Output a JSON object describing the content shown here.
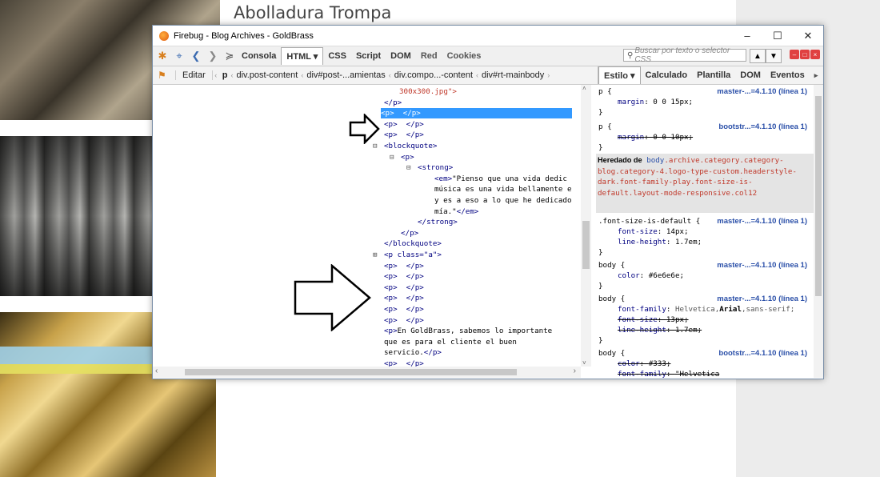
{
  "background_page": {
    "title": "Abolladura Trompa"
  },
  "window": {
    "title": "Firebug - Blog Archives - GoldBrass",
    "controls": [
      "–",
      "☐",
      "✕"
    ]
  },
  "toolbar": {
    "tabs": [
      "Consola",
      "HTML ▾",
      "CSS",
      "Script",
      "DOM",
      "Red",
      "Cookies"
    ],
    "active_tab": "HTML ▾",
    "search_placeholder": "Buscar por texto o selector CSS"
  },
  "subbar": {
    "edit_label": "Editar",
    "breadcrumbs": [
      "p",
      "div.post-content",
      "div#post-...amientas",
      "div.compo...-content",
      "div#rt-mainbody"
    ],
    "right_tabs": [
      "Estilo ▾",
      "Calculado",
      "Plantilla",
      "DOM",
      "Eventos"
    ],
    "active_right_tab": "Estilo ▾"
  },
  "html_tree": [
    {
      "text": "300x300.jpg\">",
      "indent": 308,
      "kind": "str"
    },
    {
      "text": "</p>",
      "indent": 289,
      "kind": "tag"
    },
    {
      "text": "<p>  </p>",
      "indent": 289,
      "kind": "tag",
      "selected": true
    },
    {
      "text": "<p>  </p>",
      "indent": 289,
      "kind": "tag"
    },
    {
      "text": "<p>  </p>",
      "indent": 289,
      "kind": "tag"
    },
    {
      "text": "<blockquote>",
      "indent": 289,
      "kind": "tag",
      "toggle": "⊟"
    },
    {
      "text": "<p>",
      "indent": 310,
      "kind": "tag",
      "toggle": "⊟"
    },
    {
      "text": "<strong>",
      "indent": 331,
      "kind": "tag",
      "toggle": "⊟"
    },
    {
      "text": "<em>\"Pienso que una vida dedic",
      "indent": 352,
      "kind": "mixed"
    },
    {
      "text": "música es una vida bellamente e",
      "indent": 352,
      "kind": "txt"
    },
    {
      "text": "y es a eso a lo que he dedicado",
      "indent": 352,
      "kind": "txt"
    },
    {
      "text": "mía.\"</em>",
      "indent": 352,
      "kind": "mixed2"
    },
    {
      "text": "</strong>",
      "indent": 331,
      "kind": "tag"
    },
    {
      "text": "</p>",
      "indent": 310,
      "kind": "tag"
    },
    {
      "text": "</blockquote>",
      "indent": 289,
      "kind": "tag"
    },
    {
      "text": "<p class=\"a\">",
      "indent": 289,
      "kind": "tag",
      "toggle": "⊞"
    },
    {
      "text": "<p>  </p>",
      "indent": 289,
      "kind": "tag"
    },
    {
      "text": "<p>  </p>",
      "indent": 289,
      "kind": "tag"
    },
    {
      "text": "<p>  </p>",
      "indent": 289,
      "kind": "tag"
    },
    {
      "text": "<p>  </p>",
      "indent": 289,
      "kind": "tag"
    },
    {
      "text": "<p>  </p>",
      "indent": 289,
      "kind": "tag"
    },
    {
      "text": "<p>  </p>",
      "indent": 289,
      "kind": "tag"
    },
    {
      "text": "<p>En GoldBrass, sabemos lo importante",
      "indent": 289,
      "kind": "mixed3"
    },
    {
      "text": "que es para el cliente el buen",
      "indent": 289,
      "kind": "txt"
    },
    {
      "text": "servicio.</p>",
      "indent": 289,
      "kind": "mixed4"
    },
    {
      "text": "<p>  </p>",
      "indent": 289,
      "kind": "tag"
    }
  ],
  "css_rules": {
    "rule1": {
      "selector": "p {",
      "source": "master-...=4.1.10 (línea 1)",
      "prop": "margin",
      "value": "0 0 15px;",
      "close": "}"
    },
    "rule2": {
      "selector": "p {",
      "source": "bootstr...=4.1.10 (línea 1)",
      "prop": "margin",
      "value": "0 0 10px;",
      "close": "}"
    },
    "inherited": {
      "label": "Heredado de",
      "element": "body",
      "classes": ".archive.category.category-blog.category-4.logo-type-custom.headerstyle-dark.font-family-play.font-size-is-default.layout-mode-responsive.col12"
    },
    "rule3": {
      "selector": ".font-size-is-default {",
      "source": "master-...=4.1.10 (línea 1)",
      "prop1": "font-size",
      "value1": "14px;",
      "prop2": "line-height",
      "value2": "1.7em;",
      "close": "}"
    },
    "rule4": {
      "selector": "body {",
      "source": "master-...=4.1.10 (línea 1)",
      "prop": "color",
      "value": "#6e6e6e;",
      "close": "}"
    },
    "rule5": {
      "selector": "body {",
      "source": "master-...=4.1.10 (línea 1)",
      "prop1": "font-family",
      "value1": "Helvetica,",
      "value1b": "Arial",
      "value1c": ",sans-serif;",
      "prop2": "font-size",
      "value2": "13px;",
      "prop3": "line-height",
      "value3": "1.7em;",
      "close": "}"
    },
    "rule6": {
      "selector": "body {",
      "source": "bootstr...=4.1.10 (línea 1)",
      "prop1": "color",
      "value1": "#333;",
      "prop2": "font-family",
      "value2": "\"Helvetica"
    }
  },
  "colors": {
    "selection": "#3399ff",
    "tag": "#000080",
    "string": "#c0392b",
    "source_link": "#2a4fa8"
  },
  "annotations": {
    "arrows": [
      "small-arrow-right",
      "large-arrow-right"
    ]
  }
}
